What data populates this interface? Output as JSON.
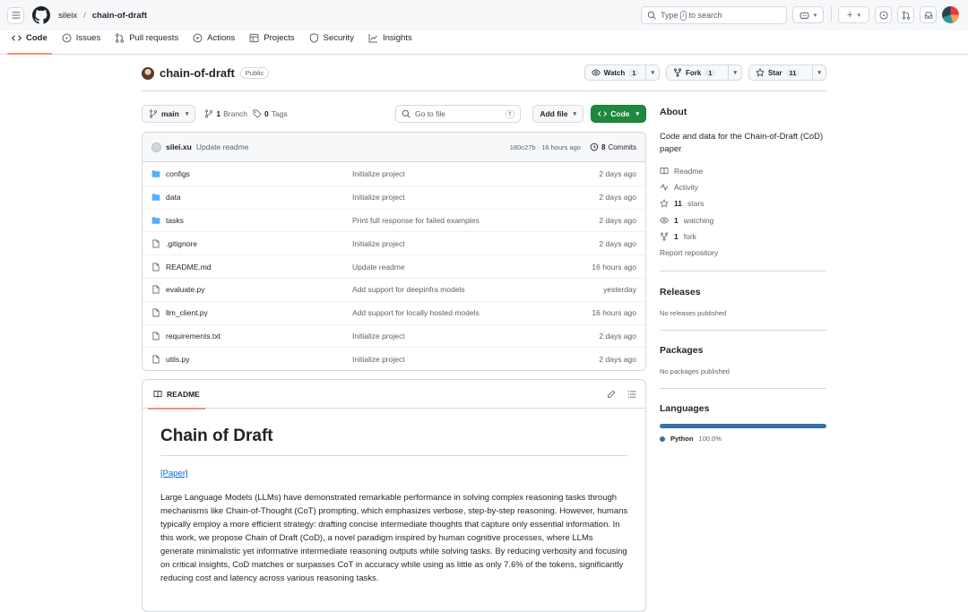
{
  "header": {
    "owner": "sileix",
    "separator": "/",
    "repo": "chain-of-draft",
    "search_prefix": "Type",
    "search_key": "/",
    "search_suffix": "to search",
    "plus_label": "+"
  },
  "tabs": [
    {
      "label": "Code",
      "icon": "code-icon"
    },
    {
      "label": "Issues",
      "icon": "issue-icon"
    },
    {
      "label": "Pull requests",
      "icon": "pull-request-icon"
    },
    {
      "label": "Actions",
      "icon": "play-icon"
    },
    {
      "label": "Projects",
      "icon": "table-icon"
    },
    {
      "label": "Security",
      "icon": "shield-icon"
    },
    {
      "label": "Insights",
      "icon": "graph-icon"
    }
  ],
  "repo": {
    "name": "chain-of-draft",
    "visibility": "Public",
    "watch_label": "Watch",
    "watch_count": "1",
    "fork_label": "Fork",
    "fork_count": "1",
    "star_label": "Star",
    "star_count": "11"
  },
  "file_bar": {
    "branch": "main",
    "branch_count": "1",
    "branch_label": "Branch",
    "tag_count": "0",
    "tag_label": "Tags",
    "goto_placeholder": "Go to file",
    "goto_key": "t",
    "add_file_label": "Add file",
    "code_label": "Code"
  },
  "last_commit": {
    "user": "silei.xu",
    "message": "Update readme",
    "meta": "180c27b · 16 hours ago",
    "commits_count": "8",
    "commits_label": "Commits"
  },
  "files": [
    {
      "name": "configs",
      "type": "folder",
      "message": "Initialize project",
      "date": "2 days ago"
    },
    {
      "name": "data",
      "type": "folder",
      "message": "Initialize project",
      "date": "2 days ago"
    },
    {
      "name": "tasks",
      "type": "folder",
      "message": "Print full response for failed examples",
      "date": "2 days ago"
    },
    {
      "name": ".gitignore",
      "type": "file",
      "message": "Initialize project",
      "date": "2 days ago"
    },
    {
      "name": "README.md",
      "type": "file",
      "message": "Update readme",
      "date": "16 hours ago"
    },
    {
      "name": "evaluate.py",
      "type": "file",
      "message": "Add support for deepinfra models",
      "date": "yesterday"
    },
    {
      "name": "llm_client.py",
      "type": "file",
      "message": "Add support for locally hosted models",
      "date": "16 hours ago"
    },
    {
      "name": "requirements.txt",
      "type": "file",
      "message": "Initialize project",
      "date": "2 days ago"
    },
    {
      "name": "utils.py",
      "type": "file",
      "message": "Initialize project",
      "date": "2 days ago"
    }
  ],
  "readme": {
    "tab_label": "README",
    "title": "Chain of Draft",
    "paper_link": "[Paper]",
    "paragraph": "Large Language Models (LLMs) have demonstrated remarkable performance in solving complex reasoning tasks through mechanisms like Chain-of-Thought (CoT) prompting, which emphasizes verbose, step-by-step reasoning. However, humans typically employ a more efficient strategy: drafting concise intermediate thoughts that capture only essential information. In this work, we propose Chain of Draft (CoD), a novel paradigm inspired by human cognitive processes, where LLMs generate minimalistic yet informative intermediate reasoning outputs while solving tasks. By reducing verbosity and focusing on critical insights, CoD matches or surpasses CoT in accuracy while using as little as only 7.6% of the tokens, significantly reducing cost and latency across various reasoning tasks."
  },
  "sidebar": {
    "about_title": "About",
    "about_desc": "Code and data for the Chain-of-Draft (CoD) paper",
    "readme_label": "Readme",
    "activity_label": "Activity",
    "stars_count": "11",
    "stars_label": "stars",
    "watching_count": "1",
    "watching_label": "watching",
    "fork_count": "1",
    "fork_label": "fork",
    "report_label": "Report repository",
    "releases_title": "Releases",
    "releases_empty": "No releases published",
    "packages_title": "Packages",
    "packages_empty": "No packages published",
    "languages_title": "Languages",
    "language_name": "Python",
    "language_percent": "100.0%",
    "language_color": "#3572A5"
  },
  "colors": {
    "accent_green": "#1f883d",
    "tab_underline": "#fd8c73",
    "link_blue": "#0969da",
    "folder_blue": "#54aeff"
  }
}
